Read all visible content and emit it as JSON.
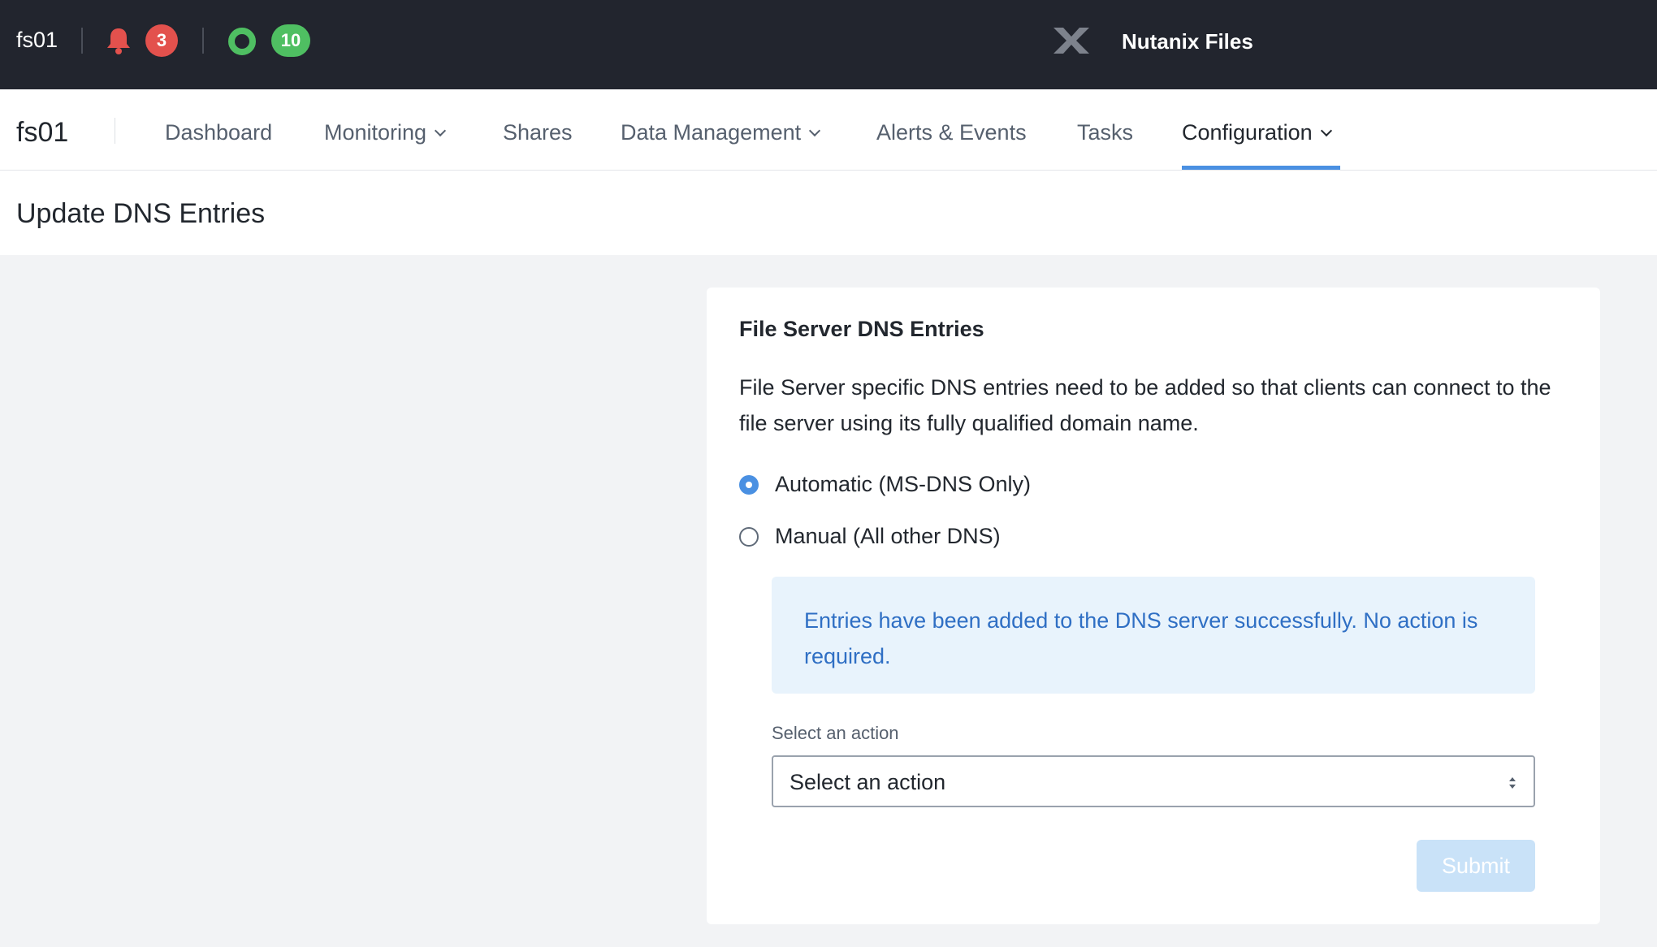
{
  "topbar": {
    "cluster_name": "fs01",
    "alerts_count": "3",
    "tasks_count": "10",
    "product_name": "Nutanix Files",
    "icons": [
      "bell-icon",
      "status-ring-icon",
      "nutanix-logo-icon"
    ],
    "colors": {
      "background": "#22252e",
      "alert_badge": "#e3514d",
      "ok_badge": "#4fbf62"
    }
  },
  "nav": {
    "file_server": "fs01",
    "items": [
      {
        "label": "Dashboard"
      },
      {
        "label": "Monitoring"
      },
      {
        "label": "Shares"
      },
      {
        "label": "Data Management"
      },
      {
        "label": "Alerts & Events"
      },
      {
        "label": "Tasks"
      },
      {
        "label": "Configuration"
      }
    ],
    "active": "Configuration",
    "accent": "#4a90e2"
  },
  "page": {
    "title": "Update DNS Entries"
  },
  "card": {
    "heading": "File Server DNS Entries",
    "description": "File Server specific DNS entries need to be added so that clients can connect to the file server using its fully qualified domain name.",
    "options": [
      {
        "label": "Automatic (MS-DNS Only)",
        "checked": true
      },
      {
        "label": "Manual (All other DNS)",
        "checked": false
      }
    ],
    "info_message": "Entries have been added to the DNS server successfully. No action is required.",
    "action_label": "Select an action",
    "action_value": "Select an action",
    "submit_label": "Submit"
  }
}
